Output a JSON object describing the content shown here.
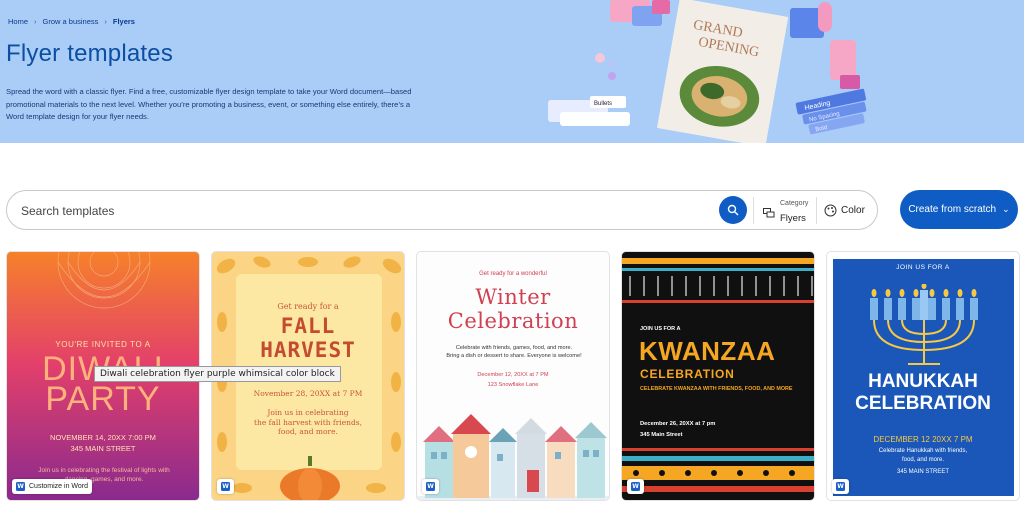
{
  "breadcrumb": {
    "items": [
      "Home",
      "Grow a business",
      "Flyers"
    ]
  },
  "hero": {
    "title": "Flyer templates",
    "description": "Spread the word with a classic flyer. Find a free, customizable flyer design template to take your Word document—based promotional materials to the next level. Whether you’re promoting a business, event, or something else entirely, there’s a Word template design for your flyer needs.",
    "art": {
      "poster_title": [
        "GRAND",
        "OPENING"
      ],
      "panel_items": [
        "Heading",
        "No Spacing",
        "Bold"
      ],
      "ui_chip": "Bullets"
    }
  },
  "search": {
    "placeholder": "Search templates",
    "category_label": "Category",
    "category_value": "Flyers",
    "color_label": "Color"
  },
  "create_button": "Create from scratch",
  "tooltip": "Diwali celebration flyer purple whimsical color block",
  "customize_label": "Customize in Word",
  "templates": [
    {
      "lines": [
        "YOU'RE INVITED TO A",
        "DIWALI",
        "PARTY",
        "NOVEMBER 14, 20XX 7:00 PM",
        "345 MAIN STREET",
        "Join us in celebrating the festival of lights with dancing, games, and more."
      ]
    },
    {
      "lines": [
        "Get ready for a",
        "FALL",
        "HARVEST",
        "November 28, 20XX at 7 PM",
        "Join us in celebrating",
        "the fall harvest with friends,",
        "food, and more."
      ]
    },
    {
      "lines": [
        "Get ready for a wonderful",
        "Winter",
        "Celebration",
        "Celebrate with friends, games, food, and more.",
        "Bring a dish or dessert to share. Everyone is welcome!",
        "December 12, 20XX at 7 PM",
        "123 Snowflake Lane"
      ]
    },
    {
      "lines": [
        "JOIN US FOR A",
        "KWANZAA",
        "CELEBRATION",
        "CELEBRATE KWANZAA WITH FRIENDS, FOOD, AND MORE",
        "December 26, 20XX at 7 pm",
        "345 Main Street"
      ]
    },
    {
      "lines": [
        "JOIN US FOR A",
        "HANUKKAH",
        "CELEBRATION",
        "DECEMBER 12 20XX 7 PM",
        "Celebrate Hanukkah with friends,",
        "food, and more.",
        "345 MAIN STREET"
      ]
    }
  ],
  "colors": {
    "accent": "#0f5cc4",
    "hero_bg": "#a9cdf7",
    "title": "#0b4ea2"
  }
}
